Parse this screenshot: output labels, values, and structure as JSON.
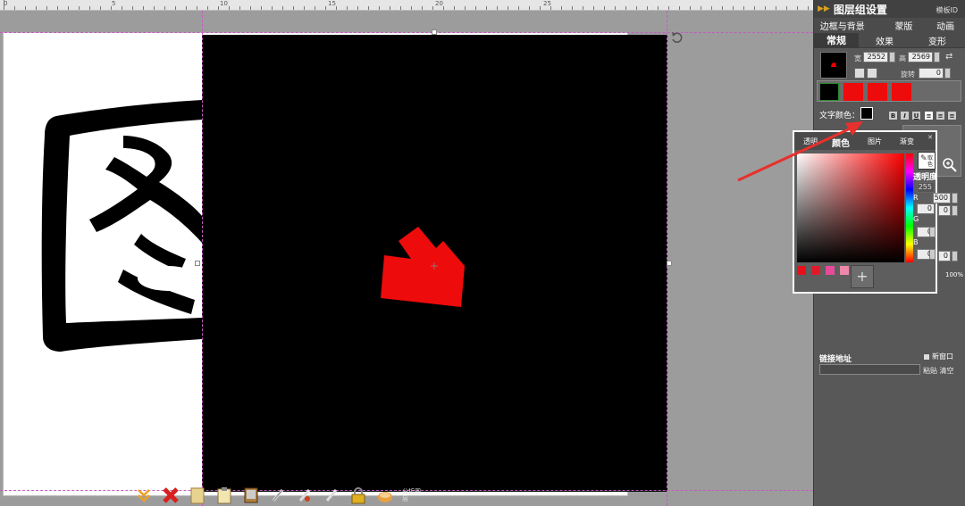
{
  "ruler": {
    "labels": [
      "0",
      "5",
      "10",
      "15",
      "20",
      "25"
    ]
  },
  "panel": {
    "title": "图层组设置",
    "template_id": "模板ID",
    "tabs_top": [
      "边框与背景",
      "蒙版",
      "动画"
    ],
    "tabs_bottom": [
      "常规",
      "效果",
      "变形"
    ],
    "active_tab": "常规",
    "width_label": "宽",
    "width_value": "2552",
    "height_label": "高",
    "height_value": "2569",
    "rotate_label": "旋转",
    "rotate_value": "0",
    "text_color_label": "文字颜色：",
    "bold": "B",
    "italic": "I",
    "underline": "U",
    "link_label": "链接地址",
    "new_window_label": "新窗口",
    "paste_clear": "粘贴 清空",
    "percent": "100%"
  },
  "color_popup": {
    "tabs": [
      "透明",
      "颜色",
      "图片",
      "渐变"
    ],
    "active_tab": "颜色",
    "eyedropper_label": "取色",
    "alpha_label": "透明度",
    "alpha_value": "255",
    "r_label": "R",
    "r_value": "500",
    "g_label": "G",
    "g_value": "0",
    "b_label": "B",
    "b_value": "0",
    "extra_values": [
      "0",
      "0",
      "0"
    ],
    "add_label": "+",
    "presets": [
      "#e8101a",
      "#e11a2a",
      "#e84a9a",
      "#ee88aa"
    ]
  },
  "bottom_bar": {
    "text_label": "分拆图层"
  },
  "colors": {
    "accent_red": "#ee0b0b",
    "panel_bg": "#585858",
    "arrow_red": "#e8302c"
  },
  "canvas": {
    "glyph_char": "图"
  }
}
